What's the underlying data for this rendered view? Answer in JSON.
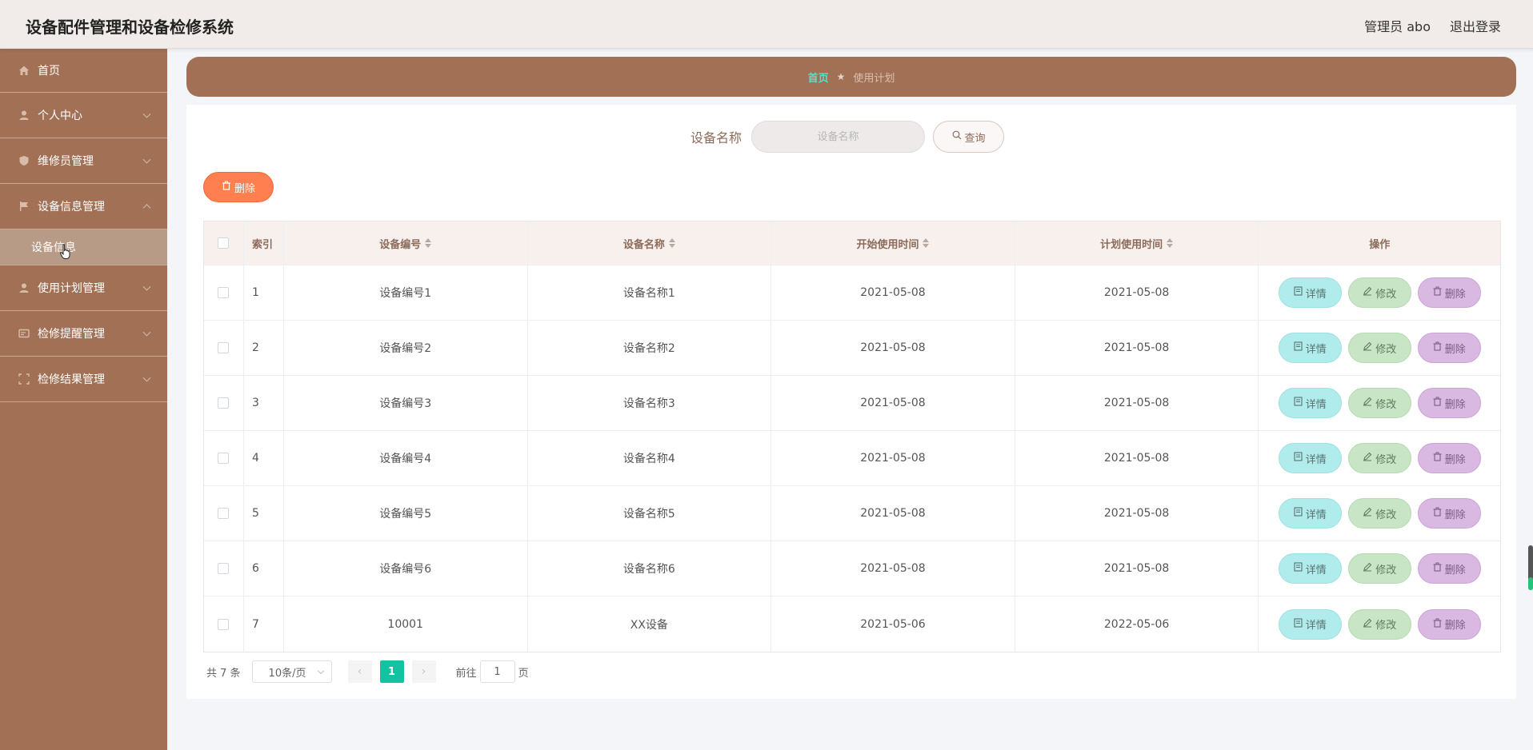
{
  "header": {
    "title": "设备配件管理和设备检修系统",
    "user_label": "管理员 abo",
    "logout_label": "退出登录"
  },
  "sidebar": {
    "items": [
      {
        "label": "首页",
        "icon": "home-icon"
      },
      {
        "label": "个人中心",
        "icon": "user-icon"
      },
      {
        "label": "维修员管理",
        "icon": "shield-icon"
      },
      {
        "label": "设备信息管理",
        "icon": "flag-icon"
      },
      {
        "label": "使用计划管理",
        "icon": "user-icon"
      },
      {
        "label": "检修提醒管理",
        "icon": "card-icon"
      },
      {
        "label": "检修结果管理",
        "icon": "frame-icon"
      }
    ],
    "submenu": {
      "label": "设备信息"
    }
  },
  "breadcrumb": {
    "home": "首页",
    "current": "使用计划"
  },
  "search": {
    "label": "设备名称",
    "placeholder": "设备名称",
    "button_label": "查询"
  },
  "toolbar": {
    "delete_label": "删除"
  },
  "table": {
    "headers": [
      "索引",
      "设备编号",
      "设备名称",
      "开始使用时间",
      "计划使用时间",
      "操作"
    ],
    "rows": [
      {
        "idx": "1",
        "code": "设备编号1",
        "name": "设备名称1",
        "start": "2021-05-08",
        "plan": "2021-05-08"
      },
      {
        "idx": "2",
        "code": "设备编号2",
        "name": "设备名称2",
        "start": "2021-05-08",
        "plan": "2021-05-08"
      },
      {
        "idx": "3",
        "code": "设备编号3",
        "name": "设备名称3",
        "start": "2021-05-08",
        "plan": "2021-05-08"
      },
      {
        "idx": "4",
        "code": "设备编号4",
        "name": "设备名称4",
        "start": "2021-05-08",
        "plan": "2021-05-08"
      },
      {
        "idx": "5",
        "code": "设备编号5",
        "name": "设备名称5",
        "start": "2021-05-08",
        "plan": "2021-05-08"
      },
      {
        "idx": "6",
        "code": "设备编号6",
        "name": "设备名称6",
        "start": "2021-05-08",
        "plan": "2021-05-08"
      },
      {
        "idx": "7",
        "code": "10001",
        "name": "XX设备",
        "start": "2021-05-06",
        "plan": "2022-05-06"
      }
    ],
    "ops": {
      "detail": "详情",
      "edit": "修改",
      "delete": "删除"
    }
  },
  "pagination": {
    "total": "共 7 条",
    "page_size": "10条/页",
    "current_page": "1",
    "goto_prefix": "前往",
    "goto_value": "1",
    "goto_suffix": "页"
  },
  "colors": {
    "sidebar": "#a27155",
    "accent": "#13c2a0",
    "delete_button": "#ff7f50"
  }
}
